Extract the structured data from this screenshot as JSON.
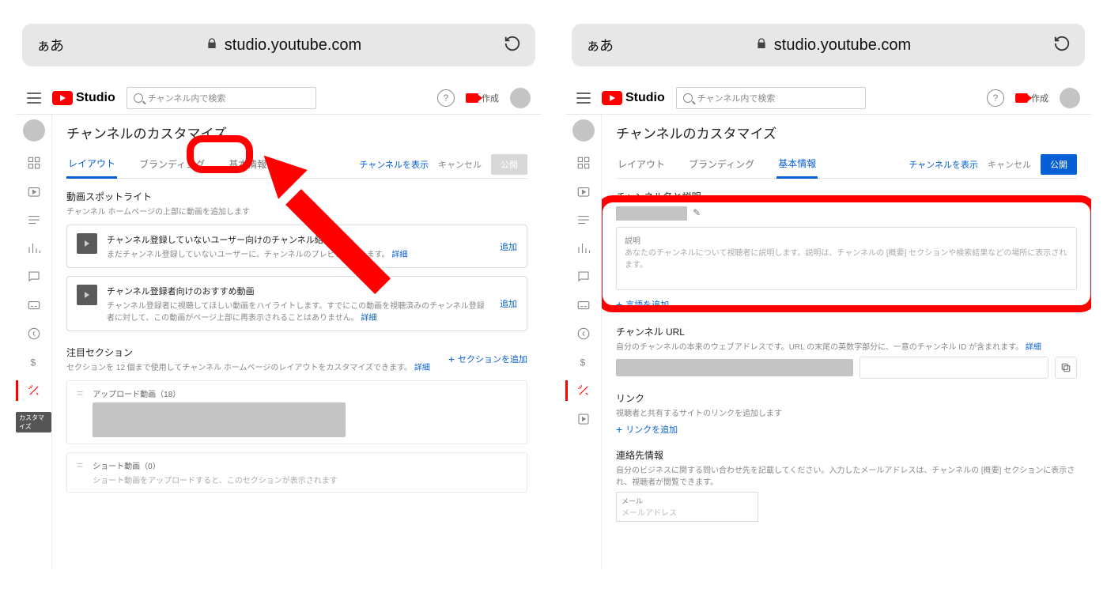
{
  "browser": {
    "aa": "ぁあ",
    "url": "studio.youtube.com"
  },
  "header": {
    "studio": "Studio",
    "search_ph": "チャンネル内で検索",
    "create": "作成"
  },
  "page": {
    "title": "チャンネルのカスタマイズ",
    "tabs": {
      "layout": "レイアウト",
      "branding": "ブランディング",
      "basic": "基本情報"
    },
    "actions": {
      "view": "チャンネルを表示",
      "cancel": "キャンセル",
      "publish": "公開"
    }
  },
  "layout": {
    "spotlight_title": "動画スポットライト",
    "spotlight_desc": "チャンネル ホームページの上部に動画を追加します",
    "card1_title": "チャンネル登録していないユーザー向けのチャンネル紹介動画",
    "card1_desc": "まだチャンネル登録していないユーザーに、チャンネルのプレビューをします。",
    "card2_title": "チャンネル登録者向けのおすすめ動画",
    "card2_desc": "チャンネル登録者に視聴してほしい動画をハイライトします。すでにこの動画を視聴済みのチャンネル登録者に対して、この動画がページ上部に再表示されることはありません。",
    "details": "詳細",
    "add": "追加",
    "featured_title": "注目セクション",
    "featured_desc": "セクションを 12 個まで使用してチャンネル ホームページのレイアウトをカスタマイズできます。",
    "add_section": "セクションを追加",
    "sec1": "アップロード動画（18）",
    "sec2_title": "ショート動画（0）",
    "sec2_desc": "ショート動画をアップロードすると、このセクションが表示されます"
  },
  "basic": {
    "name_title": "チャンネル名と説明",
    "desc_label": "説明",
    "desc_ph": "あなたのチャンネルについて視聴者に説明します。説明は、チャンネルの [概要] セクションや検索結果などの場所に表示されます。",
    "add_lang": "言語を追加",
    "url_title": "チャンネル URL",
    "url_desc": "自分のチャンネルの本来のウェブアドレスです。URL の末尾の英数字部分に、一意のチャンネル ID が含まれます。",
    "links_title": "リンク",
    "links_desc": "視聴者と共有するサイトのリンクを追加します",
    "add_link": "リンクを追加",
    "contact_title": "連絡先情報",
    "contact_desc": "自分のビジネスに関する問い合わせ先を記載してください。入力したメールアドレスは、チャンネルの [概要] セクションに表示され、視聴者が閲覧できます。",
    "mail_label": "メール",
    "mail_ph": "メールアドレス"
  },
  "side_tooltip": "カスタマイズ"
}
